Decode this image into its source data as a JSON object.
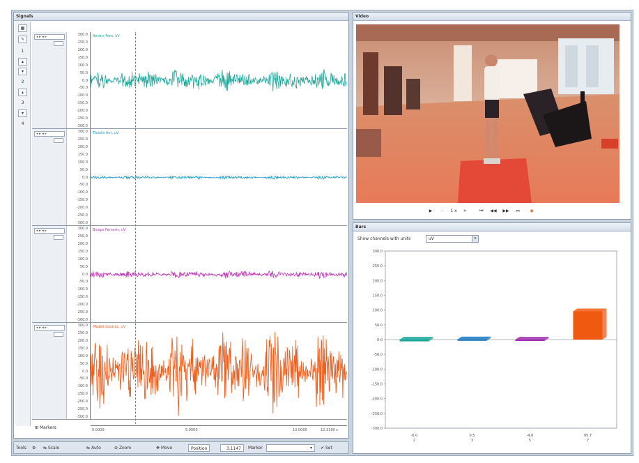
{
  "signals": {
    "title": "Signals",
    "toolbar_numbers": [
      "1",
      "2",
      "3",
      "4"
    ],
    "channels": [
      {
        "title": "Rectus Fem, uV",
        "color": "#1aa89a",
        "amp": 0.25,
        "yticks": [
          "300.0",
          "250.0",
          "200.0",
          "150.0",
          "100.0",
          "50.0",
          "0.0",
          "-50.0",
          "-100.0",
          "-150.0",
          "-200.0",
          "-250.0",
          "-300.0"
        ]
      },
      {
        "title": "Tibialis Ant, uV",
        "color": "#1a9cc8",
        "amp": 0.04,
        "yticks": [
          "300.0",
          "250.0",
          "200.0",
          "150.0",
          "100.0",
          "50.0",
          "0.0",
          "-50.0",
          "-100.0",
          "-150.0",
          "-200.0",
          "-250.0",
          "-300.0"
        ]
      },
      {
        "title": "Biceps Femoris, uV",
        "color": "#c030b8",
        "amp": 0.09,
        "yticks": [
          "300.0",
          "250.0",
          "200.0",
          "150.0",
          "100.0",
          "50.0",
          "0.0",
          "-50.0",
          "-100.0",
          "-150.0",
          "-200.0",
          "-250.0",
          "-300.0"
        ]
      },
      {
        "title": "Medial Gastroc, uV",
        "color": "#f06020",
        "amp": 1.0,
        "yticks": [
          "300.0",
          "250.0",
          "200.0",
          "150.0",
          "100.0",
          "50.0",
          "0.0",
          "-50.0",
          "-100.0",
          "-150.0",
          "-200.0",
          "-250.0",
          "-300.0"
        ]
      }
    ],
    "markers_label": "Markers",
    "xticks": [
      "0.0000",
      "5.0000",
      "10.0000",
      "12.3190 s"
    ]
  },
  "video": {
    "title": "Video",
    "controls": [
      "▶",
      "-",
      "1 x",
      "+",
      "⏮",
      "◀◀",
      "▶▶",
      "⏭"
    ]
  },
  "bars": {
    "title": "Bars",
    "filter_label": "Show channels with units",
    "filter_value": "uV",
    "chart_data": {
      "type": "bar",
      "ylim": [
        -300,
        300
      ],
      "yticks": [
        "300.0",
        "250.0",
        "200.0",
        "150.0",
        "100.0",
        "50.0",
        "0.0",
        "-50.0",
        "-100.0",
        "-150.0",
        "-200.0",
        "-250.0",
        "-300.0"
      ],
      "series": [
        {
          "value": -6.0,
          "label": "-6.0",
          "index": "2",
          "color": "#1aa89a"
        },
        {
          "value": 0.5,
          "label": "0.5",
          "index": "3",
          "color": "#1a78c0"
        },
        {
          "value": -4.0,
          "label": "-4.0",
          "index": "5",
          "color": "#a030b0"
        },
        {
          "value": 95.7,
          "label": "95.7",
          "index": "7",
          "color": "#f05a10"
        }
      ]
    }
  },
  "bottombar": {
    "tools_label": "Tools",
    "scale_label": "Scale",
    "auto_label": "Auto",
    "zoom_label": "Zoom",
    "move_label": "Move",
    "position_label": "Position",
    "position_value": "3.1147",
    "marker_label": "Marker",
    "marker_value": "",
    "set_label": "Set"
  }
}
